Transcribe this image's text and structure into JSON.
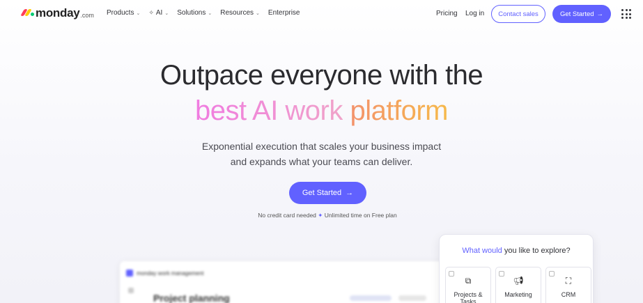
{
  "nav": {
    "logo_text": "monday",
    "logo_suffix": ".com",
    "menu": {
      "products": "Products",
      "ai": "AI",
      "solutions": "Solutions",
      "resources": "Resources",
      "enterprise": "Enterprise"
    },
    "pricing": "Pricing",
    "login": "Log in",
    "contact_sales": "Contact sales",
    "get_started": "Get Started"
  },
  "hero": {
    "line1": "Outpace everyone with the",
    "line2_a": "best AI work",
    "line2_b": "platform",
    "subtitle_1": "Exponential execution that scales your business impact",
    "subtitle_2": "and expands what your teams can deliver.",
    "cta": "Get Started",
    "note_a": "No credit card needed",
    "note_sep": "✦",
    "note_b": "Unlimited time on Free plan"
  },
  "preview": {
    "brand": "monday work management",
    "title": "Project planning"
  },
  "explore": {
    "question_hl": "What would",
    "question_rest": "you like to explore?",
    "options": [
      {
        "label": "Projects & Tasks",
        "icon": "tasks-icon"
      },
      {
        "label": "Marketing",
        "icon": "megaphone-icon"
      },
      {
        "label": "CRM",
        "icon": "crm-icon"
      }
    ]
  },
  "colors": {
    "accent": "#6161ff",
    "gradient_pink": "#f07be0",
    "gradient_orange": "#f6b94a"
  }
}
